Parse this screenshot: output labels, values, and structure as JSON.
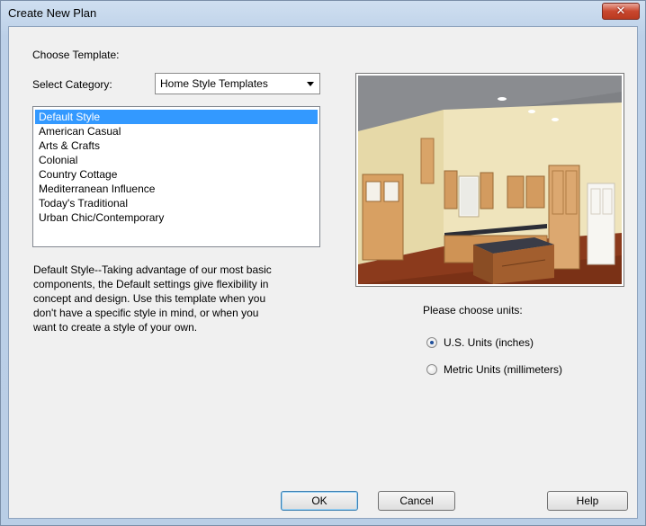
{
  "window": {
    "title": "Create New Plan",
    "close_label": "✕"
  },
  "choose_template_label": "Choose Template:",
  "category": {
    "label": "Select Category:",
    "value": "Home Style Templates"
  },
  "styles": [
    "Default Style",
    "American Casual",
    "Arts & Crafts",
    "Colonial",
    "Country Cottage",
    "Mediterranean Influence",
    "Today's Traditional",
    "Urban Chic/Contemporary"
  ],
  "selected_style": "Default Style",
  "description_lines": [
    "Default Style--Taking advantage of our most basic",
    "components, the Default settings give flexibility in",
    "concept and design. Use this template when you",
    "don't have a specific style in mind, or when you",
    "want to create a style of your own."
  ],
  "units": {
    "label": "Please choose units:",
    "options": [
      "U.S. Units (inches)",
      "Metric Units (millimeters)"
    ],
    "selected": "U.S. Units (inches)"
  },
  "buttons": {
    "ok": "OK",
    "cancel": "Cancel",
    "help": "Help"
  },
  "icons": {
    "close": "close-icon",
    "dropdown": "chevron-down-icon"
  }
}
